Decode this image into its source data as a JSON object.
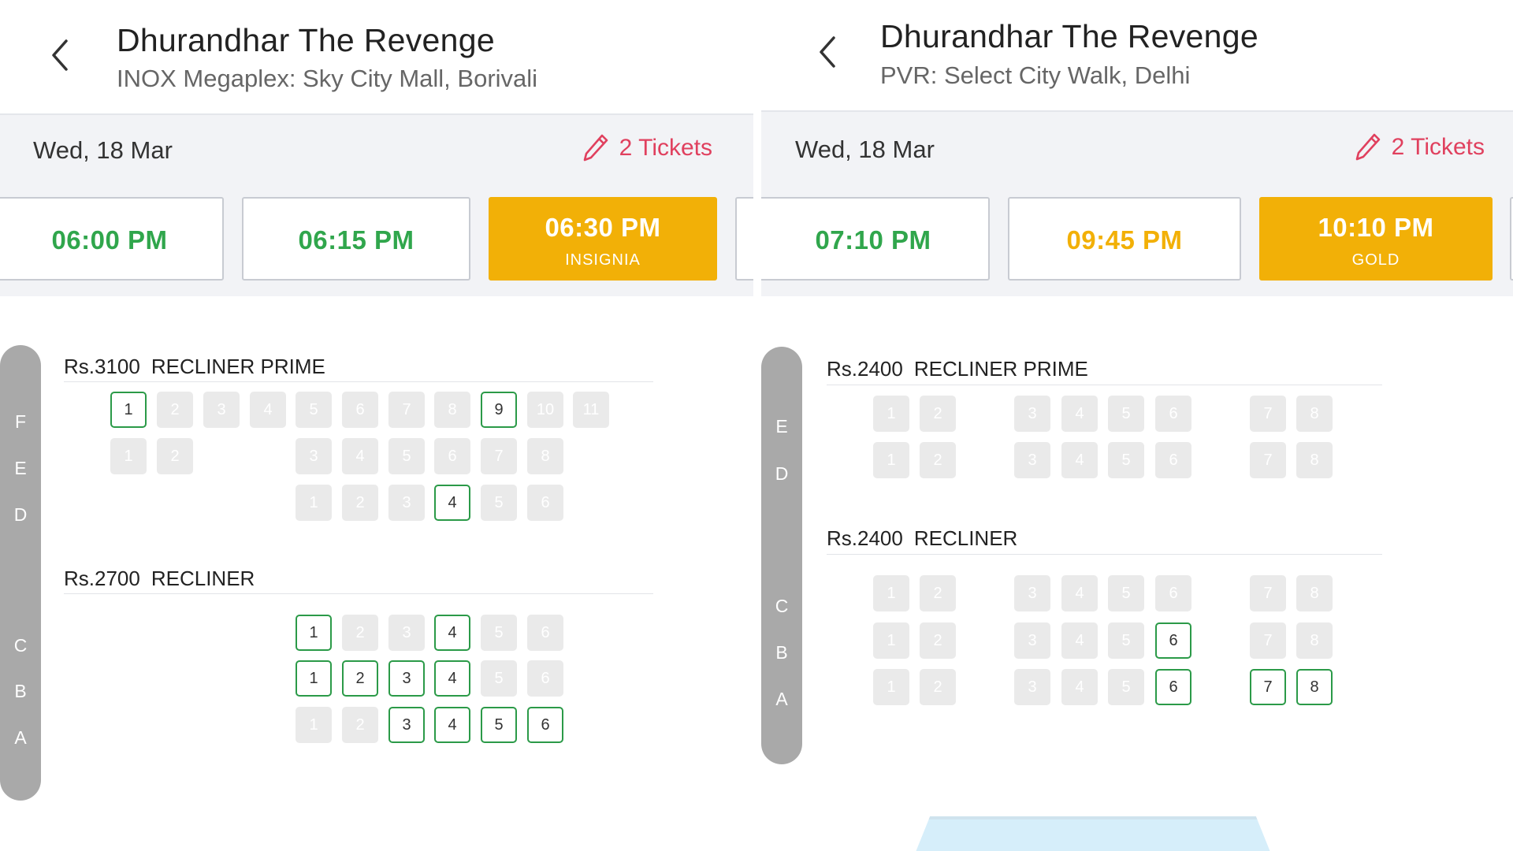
{
  "panels": [
    {
      "movie_title": "Dhurandhar The Revenge",
      "venue": "INOX Megaplex: Sky City Mall, Borivali",
      "date": "Wed, 18 Mar",
      "tickets_label": "2 Tickets",
      "showtimes": [
        {
          "time": "06:00 PM",
          "format": "",
          "state": "available"
        },
        {
          "time": "06:15 PM",
          "format": "",
          "state": "available"
        },
        {
          "time": "06:30 PM",
          "format": "INSIGNIA",
          "state": "selected"
        }
      ],
      "row_letters": [
        "F",
        "E",
        "D",
        "C",
        "B",
        "A"
      ],
      "sections": [
        {
          "price": "Rs.3100",
          "name": "RECLINER PRIME",
          "rows": [
            {
              "row": "F",
              "seats": [
                {
                  "n": "1",
                  "status": "available"
                },
                {
                  "n": "2",
                  "status": "sold"
                },
                {
                  "n": "3",
                  "status": "sold"
                },
                {
                  "n": "4",
                  "status": "sold"
                },
                {
                  "n": "5",
                  "status": "sold"
                },
                {
                  "n": "6",
                  "status": "sold"
                },
                {
                  "n": "7",
                  "status": "sold"
                },
                {
                  "n": "8",
                  "status": "sold"
                },
                {
                  "n": "9",
                  "status": "available"
                },
                {
                  "n": "10",
                  "status": "sold"
                },
                {
                  "n": "11",
                  "status": "sold"
                }
              ]
            },
            {
              "row": "E",
              "seats": [
                {
                  "n": "1",
                  "status": "sold"
                },
                {
                  "n": "2",
                  "status": "sold"
                },
                {
                  "n": "3",
                  "status": "sold"
                },
                {
                  "n": "4",
                  "status": "sold"
                },
                {
                  "n": "5",
                  "status": "sold"
                },
                {
                  "n": "6",
                  "status": "sold"
                },
                {
                  "n": "7",
                  "status": "sold"
                },
                {
                  "n": "8",
                  "status": "sold"
                }
              ]
            },
            {
              "row": "D",
              "seats": [
                {
                  "n": "1",
                  "status": "sold"
                },
                {
                  "n": "2",
                  "status": "sold"
                },
                {
                  "n": "3",
                  "status": "sold"
                },
                {
                  "n": "4",
                  "status": "available"
                },
                {
                  "n": "5",
                  "status": "sold"
                },
                {
                  "n": "6",
                  "status": "sold"
                }
              ]
            }
          ]
        },
        {
          "price": "Rs.2700",
          "name": "RECLINER",
          "rows": [
            {
              "row": "C",
              "seats": [
                {
                  "n": "1",
                  "status": "available"
                },
                {
                  "n": "2",
                  "status": "sold"
                },
                {
                  "n": "3",
                  "status": "sold"
                },
                {
                  "n": "4",
                  "status": "available"
                },
                {
                  "n": "5",
                  "status": "sold"
                },
                {
                  "n": "6",
                  "status": "sold"
                }
              ]
            },
            {
              "row": "B",
              "seats": [
                {
                  "n": "1",
                  "status": "available"
                },
                {
                  "n": "2",
                  "status": "available"
                },
                {
                  "n": "3",
                  "status": "available"
                },
                {
                  "n": "4",
                  "status": "available"
                },
                {
                  "n": "5",
                  "status": "sold"
                },
                {
                  "n": "6",
                  "status": "sold"
                }
              ]
            },
            {
              "row": "A",
              "seats": [
                {
                  "n": "1",
                  "status": "sold"
                },
                {
                  "n": "2",
                  "status": "sold"
                },
                {
                  "n": "3",
                  "status": "available"
                },
                {
                  "n": "4",
                  "status": "available"
                },
                {
                  "n": "5",
                  "status": "available"
                },
                {
                  "n": "6",
                  "status": "available"
                }
              ]
            }
          ]
        }
      ]
    },
    {
      "movie_title": "Dhurandhar The Revenge",
      "venue": "PVR: Select City Walk, Delhi",
      "date": "Wed, 18 Mar",
      "tickets_label": "2 Tickets",
      "showtimes": [
        {
          "time": "07:10 PM",
          "format": "",
          "state": "available"
        },
        {
          "time": "09:45 PM",
          "format": "",
          "state": "filling-fast"
        },
        {
          "time": "10:10 PM",
          "format": "GOLD",
          "state": "selected"
        }
      ],
      "row_letters": [
        "E",
        "D",
        "C",
        "B",
        "A"
      ],
      "sections": [
        {
          "price": "Rs.2400",
          "name": "RECLINER PRIME",
          "rows": [
            {
              "row": "E",
              "seats": [
                {
                  "n": "1",
                  "status": "sold"
                },
                {
                  "n": "2",
                  "status": "sold"
                },
                {
                  "n": "3",
                  "status": "sold"
                },
                {
                  "n": "4",
                  "status": "sold"
                },
                {
                  "n": "5",
                  "status": "sold"
                },
                {
                  "n": "6",
                  "status": "sold"
                },
                {
                  "n": "7",
                  "status": "sold"
                },
                {
                  "n": "8",
                  "status": "sold"
                }
              ]
            },
            {
              "row": "D",
              "seats": [
                {
                  "n": "1",
                  "status": "sold"
                },
                {
                  "n": "2",
                  "status": "sold"
                },
                {
                  "n": "3",
                  "status": "sold"
                },
                {
                  "n": "4",
                  "status": "sold"
                },
                {
                  "n": "5",
                  "status": "sold"
                },
                {
                  "n": "6",
                  "status": "sold"
                },
                {
                  "n": "7",
                  "status": "sold"
                },
                {
                  "n": "8",
                  "status": "sold"
                }
              ]
            }
          ]
        },
        {
          "price": "Rs.2400",
          "name": "RECLINER",
          "rows": [
            {
              "row": "C",
              "seats": [
                {
                  "n": "1",
                  "status": "sold"
                },
                {
                  "n": "2",
                  "status": "sold"
                },
                {
                  "n": "3",
                  "status": "sold"
                },
                {
                  "n": "4",
                  "status": "sold"
                },
                {
                  "n": "5",
                  "status": "sold"
                },
                {
                  "n": "6",
                  "status": "sold"
                },
                {
                  "n": "7",
                  "status": "sold"
                },
                {
                  "n": "8",
                  "status": "sold"
                }
              ]
            },
            {
              "row": "B",
              "seats": [
                {
                  "n": "1",
                  "status": "sold"
                },
                {
                  "n": "2",
                  "status": "sold"
                },
                {
                  "n": "3",
                  "status": "sold"
                },
                {
                  "n": "4",
                  "status": "sold"
                },
                {
                  "n": "5",
                  "status": "sold"
                },
                {
                  "n": "6",
                  "status": "available"
                },
                {
                  "n": "7",
                  "status": "sold"
                },
                {
                  "n": "8",
                  "status": "sold"
                }
              ]
            },
            {
              "row": "A",
              "seats": [
                {
                  "n": "1",
                  "status": "sold"
                },
                {
                  "n": "2",
                  "status": "sold"
                },
                {
                  "n": "3",
                  "status": "sold"
                },
                {
                  "n": "4",
                  "status": "sold"
                },
                {
                  "n": "5",
                  "status": "sold"
                },
                {
                  "n": "6",
                  "status": "available"
                },
                {
                  "n": "7",
                  "status": "available"
                },
                {
                  "n": "8",
                  "status": "available"
                }
              ]
            }
          ]
        }
      ]
    }
  ],
  "colors": {
    "available_border": "#2b9a48",
    "showtime_green": "#30a64c",
    "showtime_yellow": "#f2b007",
    "selected_bg": "#f2b007",
    "tickets_red": "#e0405e",
    "sold_seat": "#eaeaea",
    "row_bar": "#a9a9a9"
  },
  "icons": {
    "back": "chevron-left-icon",
    "edit": "pencil-icon"
  }
}
